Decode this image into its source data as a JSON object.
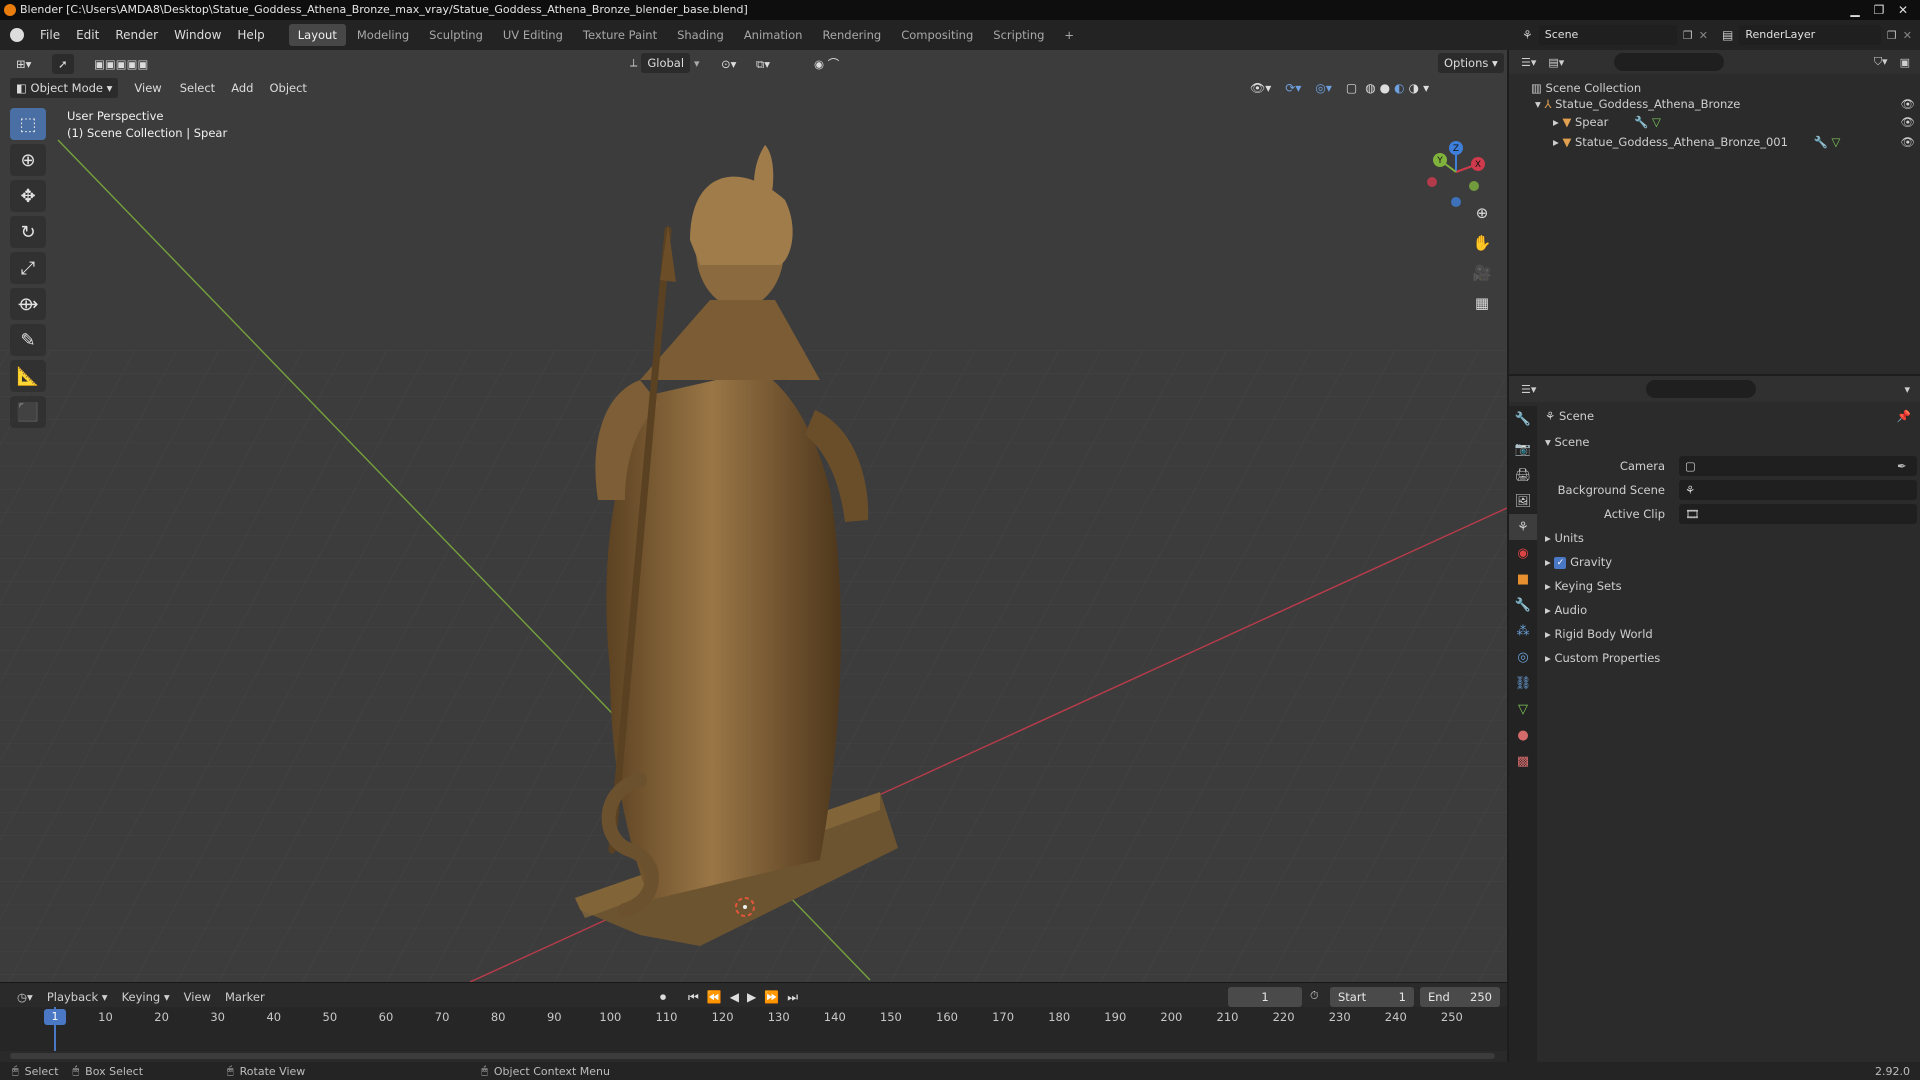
{
  "window": {
    "title": "Blender [C:\\Users\\AMDA8\\Desktop\\Statue_Goddess_Athena_Bronze_max_vray/Statue_Goddess_Athena_Bronze_blender_base.blend]"
  },
  "menu": {
    "items": [
      "File",
      "Edit",
      "Render",
      "Window",
      "Help"
    ]
  },
  "workspaces": {
    "tabs": [
      "Layout",
      "Modeling",
      "Sculpting",
      "UV Editing",
      "Texture Paint",
      "Shading",
      "Animation",
      "Rendering",
      "Compositing",
      "Scripting"
    ],
    "active": "Layout",
    "add": "+"
  },
  "topright": {
    "scene": "Scene",
    "render_layer": "RenderLayer"
  },
  "viewport": {
    "transform_orientation": "Global",
    "options": "Options",
    "mode": "Object Mode",
    "menus": [
      "View",
      "Select",
      "Add",
      "Object"
    ],
    "overlay_line1": "User Perspective",
    "overlay_line2": "(1) Scene Collection | Spear",
    "gizmo": {
      "x": "X",
      "y": "Y",
      "z": "Z"
    }
  },
  "outliner": {
    "root": "Scene Collection",
    "collection": "Statue_Goddess_Athena_Bronze",
    "objects": [
      "Spear",
      "Statue_Goddess_Athena_Bronze_001"
    ]
  },
  "properties": {
    "context": "Scene",
    "panel_title": "Scene",
    "fields": [
      {
        "label": "Camera"
      },
      {
        "label": "Background Scene"
      },
      {
        "label": "Active Clip"
      }
    ],
    "subpanels": [
      "Units",
      "Gravity",
      "Keying Sets",
      "Audio",
      "Rigid Body World",
      "Custom Properties"
    ],
    "gravity_checked": true
  },
  "timeline": {
    "menus": [
      "Playback",
      "Keying",
      "View",
      "Marker"
    ],
    "current_frame": "1",
    "start_label": "Start",
    "start": "1",
    "end_label": "End",
    "end": "250",
    "ticks": [
      "1",
      "10",
      "20",
      "30",
      "40",
      "50",
      "60",
      "70",
      "80",
      "90",
      "100",
      "110",
      "120",
      "130",
      "140",
      "150",
      "160",
      "170",
      "180",
      "190",
      "200",
      "210",
      "220",
      "230",
      "240",
      "250"
    ]
  },
  "statusbar": {
    "select": "Select",
    "box_select": "Box Select",
    "rotate_view": "Rotate View",
    "context_menu": "Object Context Menu",
    "version": "2.92.0"
  },
  "colors": {
    "accent": "#4a6fa5",
    "x_axis": "#cf3b4d",
    "y_axis": "#7fb33d",
    "z_axis": "#3d7fdb",
    "bronze": "#7a5a33"
  }
}
